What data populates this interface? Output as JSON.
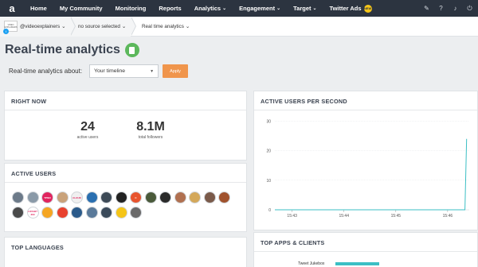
{
  "nav": {
    "logo": "a",
    "items": [
      {
        "label": "Home",
        "chevron": false
      },
      {
        "label": "My Community",
        "chevron": false
      },
      {
        "label": "Monitoring",
        "chevron": false
      },
      {
        "label": "Reports",
        "chevron": false
      },
      {
        "label": "Analytics",
        "chevron": true
      },
      {
        "label": "Engagement",
        "chevron": true
      },
      {
        "label": "Target",
        "chevron": true
      },
      {
        "label": "Twitter Ads",
        "chevron": false,
        "badge": "NEW"
      }
    ],
    "chevron_glyph": "⌄",
    "icons": [
      "pen-icon",
      "help-icon",
      "bell-icon",
      "power-icon"
    ]
  },
  "breadcrumb": {
    "avatar_text": "VIDEO EXPLAINERS",
    "account": "@videoexplainers",
    "source": "no source selected",
    "current": "Real time analytics",
    "chevron_glyph": "⌄"
  },
  "page": {
    "title": "Real-time analytics",
    "about_label": "Real-time analytics about:",
    "about_value": "Your timeline",
    "apply_label": "Apply"
  },
  "right_now": {
    "title": "RIGHT NOW",
    "active_users_value": "24",
    "active_users_label": "active users",
    "followers_value": "8.1M",
    "followers_label": "total followers"
  },
  "active_users": {
    "title": "ACTIVE USERS",
    "avatars": [
      {
        "color": "#6c7a89"
      },
      {
        "color": "#8a9aa8"
      },
      {
        "color": "#e0245e",
        "text": "TPMU"
      },
      {
        "color": "#c9a27a"
      },
      {
        "color": "#f0f0f0",
        "text": "CLOUD"
      },
      {
        "color": "#2a6fb0"
      },
      {
        "color": "#3d4a56"
      },
      {
        "color": "#222222"
      },
      {
        "color": "#e8542e",
        "text": "C"
      },
      {
        "color": "#4a5a3a"
      },
      {
        "color": "#2a2a2a"
      },
      {
        "color": "#b07050"
      },
      {
        "color": "#d4a85a"
      },
      {
        "color": "#7a5a4a"
      },
      {
        "color": "#a0522d"
      },
      {
        "color": "#4a4a4a"
      },
      {
        "color": "#ffffff",
        "text": "LOVABY 360"
      },
      {
        "color": "#f5a623"
      },
      {
        "color": "#e8412e"
      },
      {
        "color": "#2a5a8a"
      },
      {
        "color": "#5a7a9a"
      },
      {
        "color": "#3a4a5a"
      },
      {
        "color": "#f5c518"
      },
      {
        "color": "#6a6a6a"
      }
    ]
  },
  "top_languages": {
    "title": "TOP LANGUAGES"
  },
  "active_per_second": {
    "title": "ACTIVE USERS PER SECOND"
  },
  "top_apps": {
    "title": "TOP APPS & CLIENTS",
    "items": [
      {
        "label": "Tweet Jukebox",
        "value": 0.78
      }
    ]
  },
  "chart_data": {
    "type": "line",
    "title": "ACTIVE USERS PER SECOND",
    "xlabel": "",
    "ylabel": "",
    "x_ticks": [
      "15:43",
      "15:44",
      "15:45",
      "15:46"
    ],
    "y_ticks": [
      0,
      10,
      20,
      30
    ],
    "ylim": [
      0,
      32
    ],
    "series": [
      {
        "color": "#3bbfc4",
        "points": [
          {
            "x": "15:42:40",
            "y": 0
          },
          {
            "x": "15:43:00",
            "y": 0
          },
          {
            "x": "15:44:00",
            "y": 0
          },
          {
            "x": "15:45:00",
            "y": 0
          },
          {
            "x": "15:46:00",
            "y": 0
          },
          {
            "x": "15:46:20",
            "y": 0
          },
          {
            "x": "15:46:22",
            "y": 24
          }
        ]
      }
    ],
    "grid": true
  }
}
